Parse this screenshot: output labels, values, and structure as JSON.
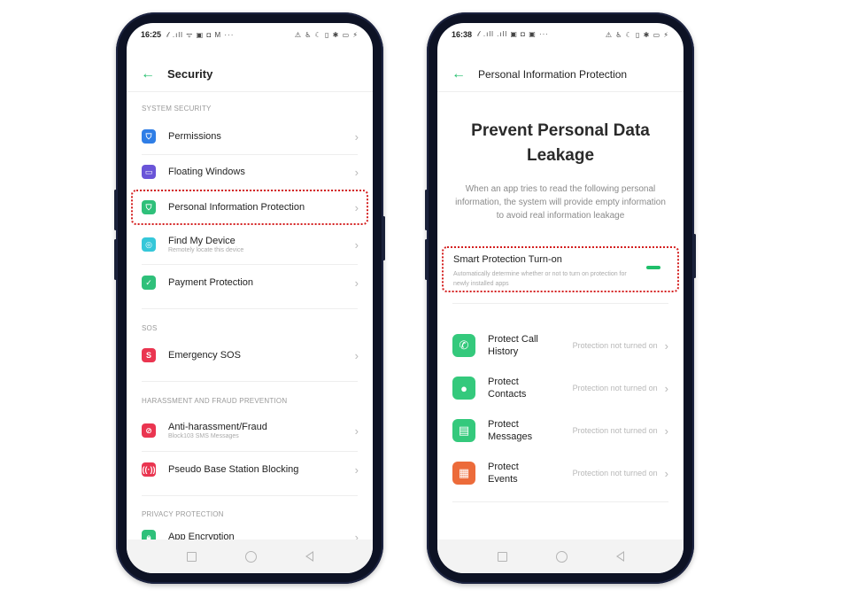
{
  "colors": {
    "accent": "#1fbf6a",
    "highlight": "#d42020",
    "frame": "#0d1224"
  },
  "left": {
    "status": {
      "time": "16:25",
      "left_icons": "𝓁 .ıll ᯤ ▣ ◘ M ···",
      "right_icons": "⚠ ♿ ☾ ▯ ✱ ▭ ⚡"
    },
    "header": {
      "title": "Security"
    },
    "sections": {
      "system_security": "SYSTEM SECURITY",
      "sos": "SOS",
      "harassment": "HARASSMENT AND FRAUD PREVENTION",
      "privacy": "PRIVACY PROTECTION"
    },
    "rows": {
      "permissions": {
        "title": "Permissions",
        "icon": "shield-icon",
        "color": "#2f7ee6"
      },
      "floating_windows": {
        "title": "Floating Windows",
        "icon": "window-icon",
        "color": "#6a55d8"
      },
      "personal_info": {
        "title": "Personal Information Protection",
        "icon": "shield-icon",
        "color": "#2fc07a"
      },
      "find_my_device": {
        "title": "Find My Device",
        "subtitle": "Remotely locate this device",
        "icon": "locate-icon",
        "color": "#35c7d9"
      },
      "payment": {
        "title": "Payment Protection",
        "icon": "shield-check-icon",
        "color": "#2fc07a"
      },
      "emergency_sos": {
        "title": "Emergency SOS",
        "icon": "sos-icon",
        "color": "#ea3550"
      },
      "anti_harassment": {
        "title": "Anti-harassment/Fraud",
        "subtitle": "Block103 SMS Messages",
        "icon": "block-icon",
        "color": "#ea3550"
      },
      "pseudo_base": {
        "title": "Pseudo Base Station Blocking",
        "icon": "antenna-icon",
        "color": "#ea3550"
      },
      "app_encryption": {
        "title": "App Encryption",
        "icon": "lock-icon",
        "color": "#2fc07a"
      }
    }
  },
  "right": {
    "status": {
      "time": "16:38",
      "left_icons": "𝓁 .ıll .ıll ▣ ◘ ▣ ···",
      "right_icons": "⚠ ♿ ☾ ▯ ✱ ▭ ⚡"
    },
    "header": {
      "title": "Personal Information Protection"
    },
    "big_title": "Prevent Personal Data Leakage",
    "description": "When an app tries to read the following personal information, the system will provide empty information to avoid real information leakage",
    "smart": {
      "title": "Smart Protection Turn-on",
      "subtitle": "Automatically determine whether or not to turn on protection for newly installed apps"
    },
    "items": [
      {
        "title": "Protect Call History",
        "status": "Protection not turned on",
        "icon": "phone-icon",
        "color": "#34c97c",
        "glyph": "✆"
      },
      {
        "title": "Protect Contacts",
        "status": "Protection not turned on",
        "icon": "contact-icon",
        "color": "#34c97c",
        "glyph": "👤"
      },
      {
        "title": "Protect Messages",
        "status": "Protection not turned on",
        "icon": "message-icon",
        "color": "#34c97c",
        "glyph": "▤"
      },
      {
        "title": "Protect Events",
        "status": "Protection not turned on",
        "icon": "calendar-icon",
        "color": "#ec6b3a",
        "glyph": "▦"
      }
    ]
  }
}
